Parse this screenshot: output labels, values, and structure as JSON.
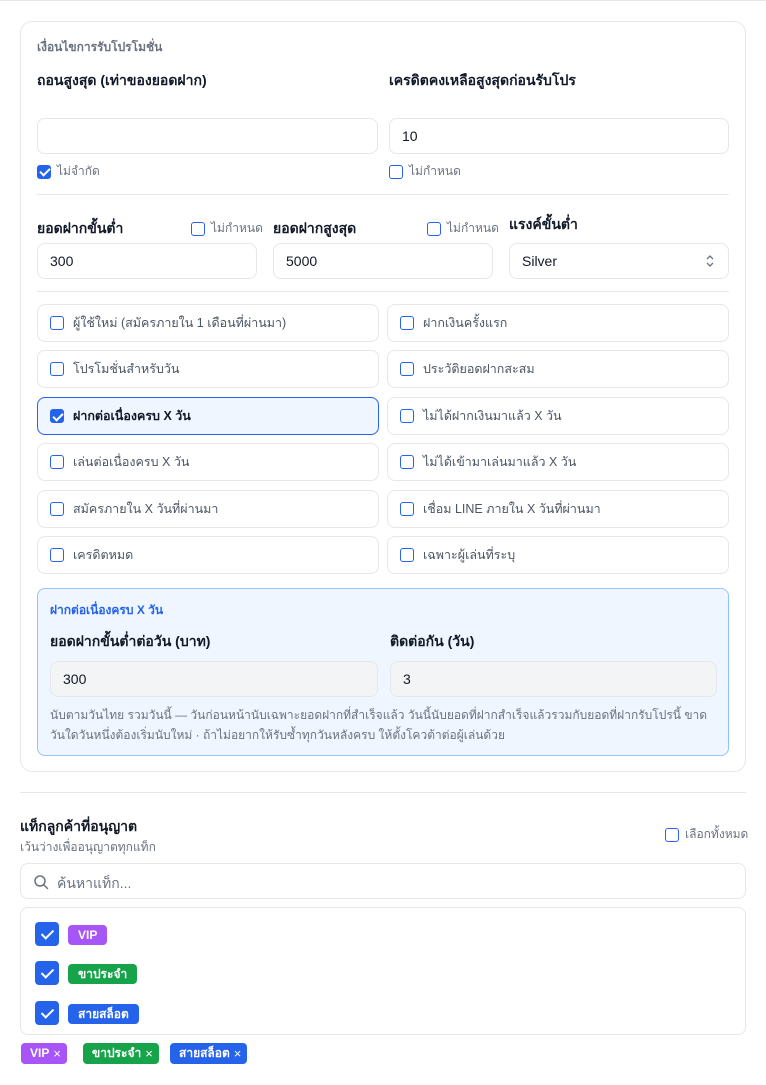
{
  "promo_conditions": {
    "section_title": "เงื่อนไขการรับโปรโมชั่น",
    "max_withdraw": {
      "label": "ถอนสูงสุด (เท่าของยอดฝาก)",
      "value": "",
      "checkbox_label": "ไม่จำกัด",
      "checked": true
    },
    "max_credit": {
      "label": "เครดิตคงเหลือสูงสุดก่อนรับโปร",
      "value": "10",
      "checkbox_label": "ไม่กำหนด",
      "checked": false
    },
    "min_deposit": {
      "label": "ยอดฝากขั้นต่ำ",
      "value": "300",
      "checkbox_label": "ไม่กำหนด",
      "checked": false
    },
    "max_deposit": {
      "label": "ยอดฝากสูงสุด",
      "value": "5000",
      "checkbox_label": "ไม่กำหนด",
      "checked": false
    },
    "min_rank": {
      "label": "แรงค์ขั้นต่ำ",
      "value": "Silver"
    },
    "options": [
      {
        "label": "ผู้ใช้ใหม่ (สมัครภายใน 1 เดือนที่ผ่านมา)",
        "checked": false
      },
      {
        "label": "ฝากเงินครั้งแรก",
        "checked": false
      },
      {
        "label": "โปรโมชั่นสำหรับวัน",
        "checked": false
      },
      {
        "label": "ประวัติยอดฝากสะสม",
        "checked": false
      },
      {
        "label": "ฝากต่อเนื่องครบ X วัน",
        "checked": true
      },
      {
        "label": "ไม่ได้ฝากเงินมาแล้ว X วัน",
        "checked": false
      },
      {
        "label": "เล่นต่อเนื่องครบ X วัน",
        "checked": false
      },
      {
        "label": "ไม่ได้เข้ามาเล่นมาแล้ว X วัน",
        "checked": false
      },
      {
        "label": "สมัครภายใน X วันที่ผ่านมา",
        "checked": false
      },
      {
        "label": "เชื่อม LINE ภายใน X วันที่ผ่านมา",
        "checked": false
      },
      {
        "label": "เครดิตหมด",
        "checked": false
      },
      {
        "label": "เฉพาะผู้เล่นที่ระบุ",
        "checked": false
      }
    ],
    "streak_panel": {
      "title": "ฝากต่อเนื่องครบ X วัน",
      "min_daily_label": "ยอดฝากขั้นต่ำต่อวัน (บาท)",
      "min_daily_value": "300",
      "days_label": "ติดต่อกัน (วัน)",
      "days_value": "3",
      "note": "นับตามวันไทย รวมวันนี้ — วันก่อนหน้านับเฉพาะยอดฝากที่สำเร็จแล้ว วันนี้นับยอดที่ฝากสำเร็จแล้วรวมกับยอดที่ฝากรับโปรนี้ ขาดวันใดวันหนึ่งต้องเริ่มนับใหม่ · ถ้าไม่อยากให้รับซ้ำทุกวันหลังครบ ให้ตั้งโควต้าต่อผู้เล่นด้วย"
    }
  },
  "tags": {
    "title": "แท็กลูกค้าที่อนุญาต",
    "subtitle": "เว้นว่างเพื่ออนุญาตทุกแท็ก",
    "select_all_label": "เลือกทั้งหมด",
    "search_placeholder": "ค้นหาแท็ก...",
    "list": [
      {
        "label": "VIP",
        "color": "#a855f7",
        "checked": true
      },
      {
        "label": "ขาประจำ",
        "color": "#16a34a",
        "checked": true
      },
      {
        "label": "สายสล็อต",
        "color": "#2563eb",
        "checked": true
      }
    ],
    "selected_chips": [
      {
        "label": "VIP",
        "color": "#a855f7"
      },
      {
        "label": "ขาประจำ",
        "color": "#16a34a"
      },
      {
        "label": "สายสล็อต",
        "color": "#2563eb"
      }
    ],
    "remove_glyph": "×"
  },
  "colors": {
    "accent": "#2563eb",
    "border": "#e5e7eb",
    "panel_bg": "#eff6ff"
  }
}
